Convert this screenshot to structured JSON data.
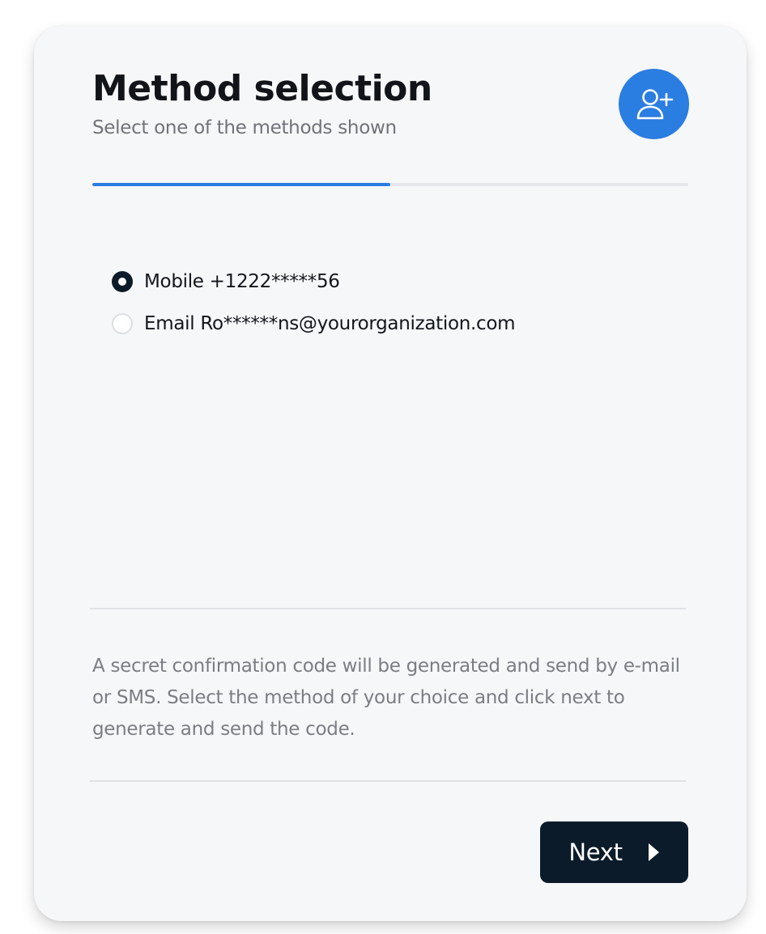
{
  "header": {
    "title": "Method selection",
    "subtitle": "Select one of the methods shown",
    "icon": "user-plus-icon"
  },
  "progress": {
    "percent": 50
  },
  "methods": [
    {
      "label": "Mobile +1222*****56",
      "selected": true
    },
    {
      "label": "Email Ro******ns@yourorganization.com",
      "selected": false
    }
  ],
  "info_text": "A secret confirmation code will be generated and send by e-mail or SMS. Select the method of your choice and click next to generate and send the code.",
  "footer": {
    "next_label": "Next",
    "next_icon": "caret-right-icon"
  },
  "colors": {
    "accent": "#2a7de1",
    "dark": "#0b1b2a",
    "card_bg": "#f6f7f9"
  }
}
